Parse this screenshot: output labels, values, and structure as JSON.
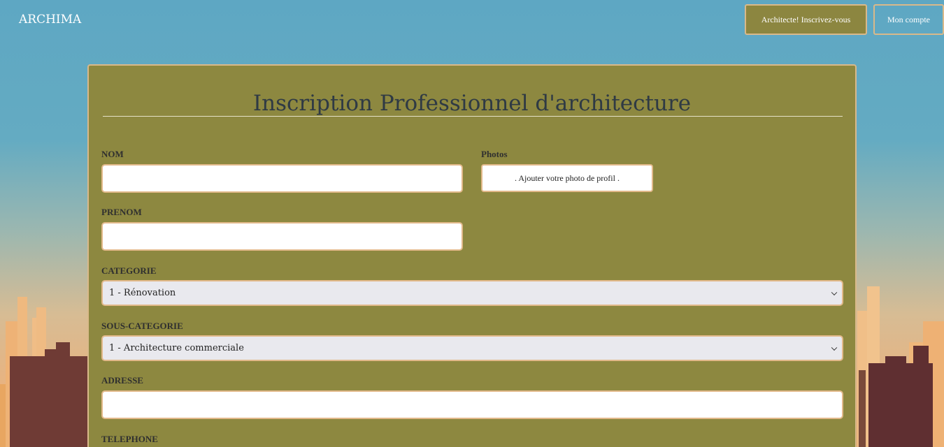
{
  "header": {
    "brand": "ARCHIMA",
    "register_button": "Architecte! Inscrivez-vous",
    "account_button": "Mon compte"
  },
  "form": {
    "title": "Inscription Professionnel d'architecture",
    "nom_label": "NOM",
    "nom_value": "",
    "photos_label": "Photos",
    "photo_button": ". Ajouter votre photo de profil .",
    "prenom_label": "PRENOM",
    "prenom_value": "",
    "categorie_label": "CATEGORIE",
    "categorie_value": "1 - Rénovation",
    "sous_categorie_label": "SOUS-CATEGORIE",
    "sous_categorie_value": "1 - Architecture commerciale",
    "adresse_label": "ADRESSE",
    "adresse_value": "",
    "telephone_label": "TELEPHONE"
  },
  "colors": {
    "card_bg": "#8d8840",
    "accent_border": "#d9b98a",
    "sky": "#62a9c3"
  }
}
